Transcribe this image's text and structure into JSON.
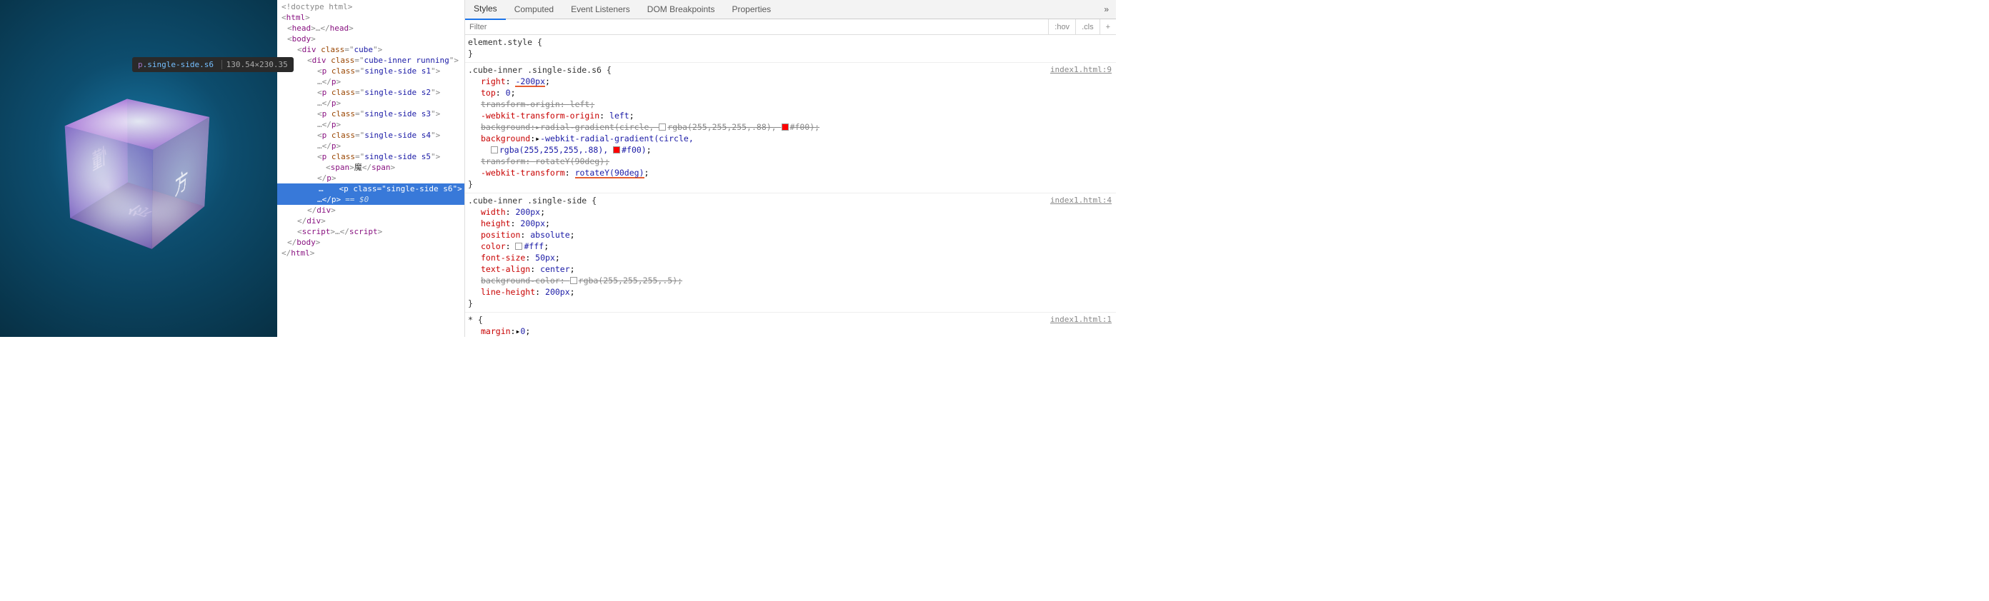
{
  "tooltip": {
    "tag": "p",
    "selector": ".single-side.s6",
    "dimensions": "130.54×230.35"
  },
  "cube_faces": {
    "left": "懂",
    "right": "方",
    "bottom": "你",
    "span_s5": "魔"
  },
  "dom": {
    "doctype": "<!doctype html>",
    "html_open": "html",
    "head": "head",
    "body": "body",
    "div_cube": {
      "tag": "div",
      "class": "cube"
    },
    "div_inner": {
      "tag": "div",
      "class": "cube-inner running"
    },
    "p1": {
      "tag": "p",
      "class": "single-side s1"
    },
    "p2": {
      "tag": "p",
      "class": "single-side s2"
    },
    "p3": {
      "tag": "p",
      "class": "single-side s3"
    },
    "p4": {
      "tag": "p",
      "class": "single-side s4"
    },
    "p5": {
      "tag": "p",
      "class": "single-side s5"
    },
    "span5": "魔",
    "p6": {
      "tag": "p",
      "class": "single-side s6"
    },
    "eq0": "== $0",
    "script": "script"
  },
  "tabs": {
    "styles": "Styles",
    "computed": "Computed",
    "listeners": "Event Listeners",
    "dom_breakpoints": "DOM Breakpoints",
    "properties": "Properties",
    "more": "»"
  },
  "filter": {
    "placeholder": "Filter",
    "hov": ":hov",
    "cls": ".cls",
    "plus": "+"
  },
  "rules": {
    "r0": {
      "selector": "element.style",
      "src": ""
    },
    "r1": {
      "selector": ".cube-inner .single-side.s6",
      "src": "index1.html:9",
      "decls": [
        {
          "prop": "right",
          "val": "-200px",
          "underline": true
        },
        {
          "prop": "top",
          "val": "0"
        },
        {
          "prop": "transform-origin",
          "val": "left",
          "over": true
        },
        {
          "prop": "-webkit-transform-origin",
          "val": "left"
        },
        {
          "prop": "background",
          "val_pre": "radial-gradient(circle, ",
          "sw1": "swhite",
          "mid": "rgba(255,255,255,.88), ",
          "sw2": "sred",
          "end": "#f00)",
          "over": true
        },
        {
          "prop": "background",
          "val_pre": "-webkit-radial-gradient(circle, ",
          "sw1": "swhite",
          "mid": "rgba(255,255,255,.88), ",
          "sw2": "sred",
          "end": "#f00)",
          "wrap": true
        },
        {
          "prop": "transform",
          "val": "rotateY(90deg)",
          "over": true
        },
        {
          "prop": "-webkit-transform",
          "val": "rotateY(90deg)",
          "underline": true
        }
      ]
    },
    "r2": {
      "selector": ".cube-inner .single-side",
      "src": "index1.html:4",
      "decls": [
        {
          "prop": "width",
          "val": "200px"
        },
        {
          "prop": "height",
          "val": "200px"
        },
        {
          "prop": "position",
          "val": "absolute"
        },
        {
          "prop": "color",
          "val": "#fff",
          "swatch": "swhite"
        },
        {
          "prop": "font-size",
          "val": "50px"
        },
        {
          "prop": "text-align",
          "val": "center"
        },
        {
          "prop": "background-color",
          "val": "rgba(255,255,255,.5)",
          "swatch": "sgrey",
          "over": true
        },
        {
          "prop": "line-height",
          "val": "200px"
        }
      ]
    },
    "r3": {
      "selector": "*",
      "src": "index1.html:1",
      "decls": [
        {
          "prop": "margin",
          "val": "0",
          "partial": true
        }
      ]
    }
  }
}
